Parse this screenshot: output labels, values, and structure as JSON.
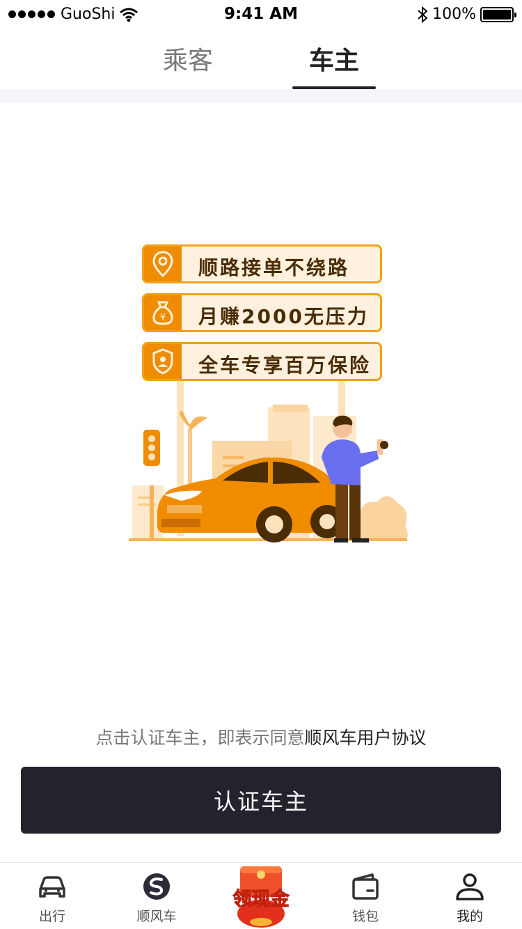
{
  "status_bar": {
    "carrier": "GuoShi",
    "time": "9:41 AM",
    "battery": "100%",
    "battery_level": 1.0
  },
  "tabs": [
    {
      "label": "乘客",
      "active": false
    },
    {
      "label": "车主",
      "active": true
    }
  ],
  "banners": [
    {
      "icon": "location-pin-icon",
      "text": "顺路接单不绕路"
    },
    {
      "icon": "money-bag-icon",
      "text": "月赚2000无压力"
    },
    {
      "icon": "shield-user-icon",
      "text": "全车专享百万保险"
    }
  ],
  "agreement": {
    "prefix": "点击认证车主，即表示同意",
    "link": "顺风车用户协议"
  },
  "cta_label": "认证车主",
  "promo_badge": "领现金",
  "bottom_nav": [
    {
      "label": "出行",
      "icon": "car-icon"
    },
    {
      "label": "顺风车",
      "icon": "hitch-logo-icon"
    },
    {
      "label": "钱包",
      "icon": "wallet-icon"
    },
    {
      "label": "我的",
      "icon": "user-icon"
    }
  ],
  "colors": {
    "accent": "#f08c00",
    "cta_bg": "#23232e"
  }
}
